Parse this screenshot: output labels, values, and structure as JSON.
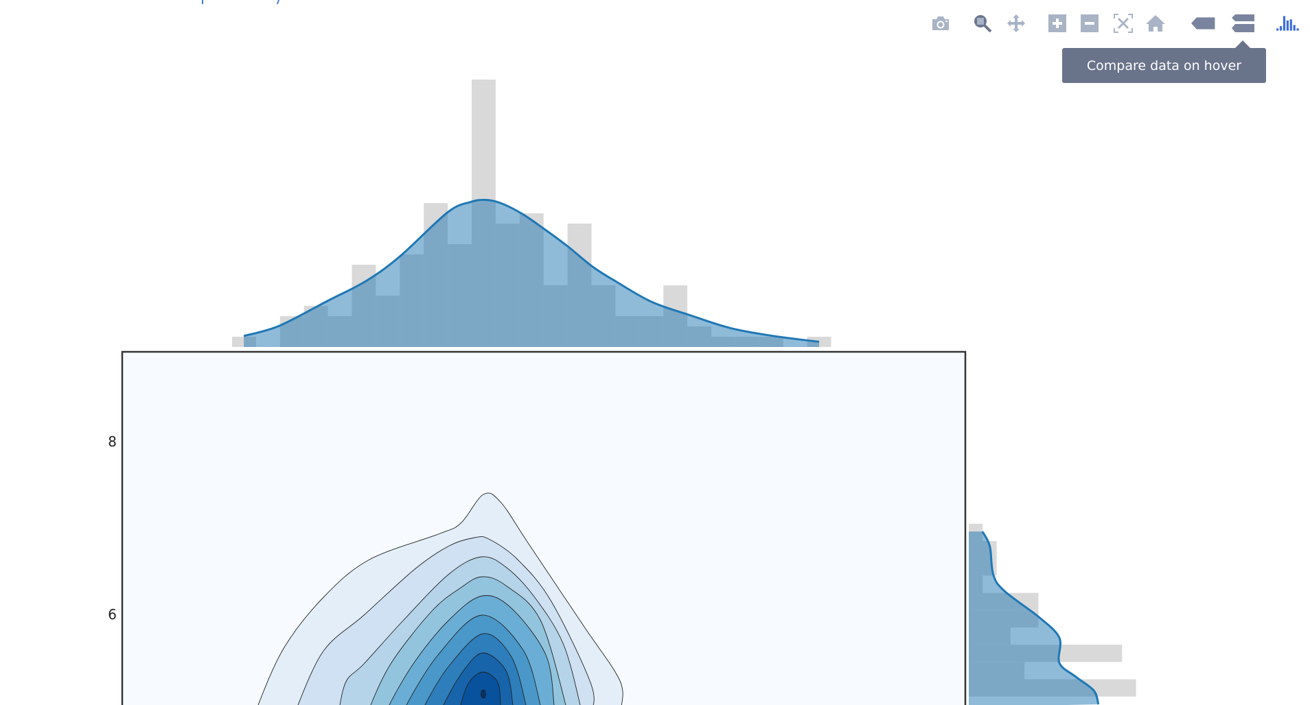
{
  "toolbar": {
    "buttons": [
      {
        "icon": "camera-icon",
        "active": false
      },
      {
        "icon": "zoom-icon",
        "active": true
      },
      {
        "icon": "pan-icon",
        "active": false
      },
      {
        "icon": "zoom-in-icon",
        "active": false
      },
      {
        "icon": "zoom-out-icon",
        "active": false
      },
      {
        "icon": "autoscale-icon",
        "active": false
      },
      {
        "icon": "reset-axes-home-icon",
        "active": false
      },
      {
        "icon": "show-closest-data-icon",
        "active": false
      },
      {
        "icon": "compare-data-icon",
        "active": false,
        "hovered": true
      },
      {
        "icon": "plotly-logo-icon",
        "active": false
      }
    ],
    "tooltip": "Compare data on hover",
    "colors": {
      "inactive": "#a9b3c6",
      "active": "#6b7590",
      "hover_mode": "#7a849e",
      "logo": "#3f6fd8"
    }
  },
  "chart_data": [
    {
      "type": "bar",
      "role": "top-marginal-histogram",
      "bin_index": [
        0,
        1,
        2,
        3,
        4,
        5,
        6,
        7,
        8,
        9,
        10,
        11,
        12,
        13,
        14,
        15,
        16,
        17,
        18,
        19,
        20,
        21,
        22,
        23,
        24
      ],
      "values": [
        1,
        0,
        3,
        4,
        3,
        8,
        5,
        9,
        14,
        10,
        26,
        12,
        13,
        6,
        12,
        6,
        3,
        3,
        6,
        2,
        1,
        1,
        1,
        0,
        1
      ],
      "color": "#d9d9d9"
    },
    {
      "type": "area",
      "role": "top-marginal-kde",
      "x": [
        0.49,
        1.98,
        4.0,
        5.58,
        7.0,
        9.0,
        9.96,
        10.58,
        11.2,
        12.07,
        12.95,
        14.0,
        15.05,
        16.0,
        17.5,
        19.1,
        20.8,
        22.6,
        24.5
      ],
      "y": [
        1.07,
        2.07,
        4.5,
        6.4,
        8.8,
        13.1,
        14.1,
        14.3,
        14.0,
        13.0,
        11.6,
        9.8,
        7.8,
        6.4,
        4.4,
        3.1,
        1.84,
        1.07,
        0.51
      ],
      "line_color": "#1f77b4",
      "fill_color": "rgba(31,119,180,0.5)"
    },
    {
      "type": "bar",
      "orientation": "horizontal",
      "role": "right-marginal-histogram",
      "y": [
        6.95,
        6.75,
        6.55,
        6.35,
        6.15,
        5.95,
        5.75,
        5.55,
        5.35,
        5.15
      ],
      "values": [
        1,
        2,
        2,
        1,
        5,
        5,
        3,
        11,
        4,
        12
      ],
      "color": "#d9d9d9"
    },
    {
      "type": "area",
      "role": "right-marginal-kde",
      "y": [
        6.96,
        6.79,
        6.46,
        6.27,
        5.97,
        5.73,
        5.44,
        5.28,
        5.12,
        4.96
      ],
      "x": [
        0.98,
        1.51,
        1.76,
        2.57,
        5.03,
        6.5,
        6.5,
        7.67,
        8.97,
        9.3
      ],
      "line_color": "#1f77b4",
      "fill_color": "rgba(31,119,180,0.5)"
    },
    {
      "type": "contour",
      "role": "joint-density",
      "colorscale": [
        "#f7fbff",
        "#e3eef9",
        "#cfe1f2",
        "#b5d4e9",
        "#93c4de",
        "#6aaed6",
        "#4a98c9",
        "#2e7ebc",
        "#1764ab",
        "#08519c",
        "#08306b"
      ],
      "line_color": "#222222",
      "yaxis": {
        "ticks": [
          8,
          6
        ],
        "tick_labels": [
          "8",
          "6"
        ]
      },
      "grid": false
    }
  ]
}
